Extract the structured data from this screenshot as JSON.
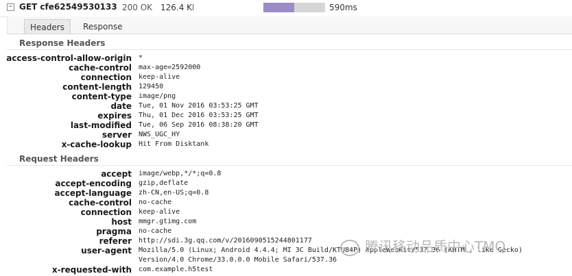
{
  "request": {
    "toggle_symbol": "−",
    "url": "GET cfe62549530133c",
    "status": "200 OK",
    "size": "126.4 KB",
    "time": "590ms",
    "timeline_fraction": 0.5
  },
  "tabs": [
    {
      "label": "Headers",
      "active": true
    },
    {
      "label": "Response",
      "active": false
    }
  ],
  "response_headers": {
    "title": "Response Headers",
    "rows": [
      {
        "name": "access-control-allow-origin",
        "value": "*"
      },
      {
        "name": "cache-control",
        "value": "max-age=2592000"
      },
      {
        "name": "connection",
        "value": "keep-alive"
      },
      {
        "name": "content-length",
        "value": "129450"
      },
      {
        "name": "content-type",
        "value": "image/png"
      },
      {
        "name": "date",
        "value": "Tue, 01 Nov 2016 03:53:25 GMT"
      },
      {
        "name": "expires",
        "value": "Thu, 01 Dec 2016 03:53:25 GMT"
      },
      {
        "name": "last-modified",
        "value": "Tue, 06 Sep 2016 08:38:20 GMT"
      },
      {
        "name": "server",
        "value": "NWS_UGC_HY"
      },
      {
        "name": "x-cache-lookup",
        "value": "Hit From Disktank"
      }
    ]
  },
  "request_headers": {
    "title": "Request Headers",
    "rows": [
      {
        "name": "accept",
        "value": "image/webp,*/*;q=0.8"
      },
      {
        "name": "accept-encoding",
        "value": "gzip,deflate"
      },
      {
        "name": "accept-language",
        "value": "zh-CN,en-US;q=0.8"
      },
      {
        "name": "cache-control",
        "value": "no-cache"
      },
      {
        "name": "connection",
        "value": "keep-alive"
      },
      {
        "name": "host",
        "value": "mmgr.gtimg.com"
      },
      {
        "name": "pragma",
        "value": "no-cache"
      },
      {
        "name": "referer",
        "value": "http://sdi.3g.qq.com/v/2016090515244801177"
      },
      {
        "name": "user-agent",
        "value": "Mozilla/5.0 (Linux; Android 4.4.4; MI 3C Build/KTU84P) AppleWebKit/537.36 (KHTML, like Gecko) Version/4.0 Chrome/33.0.0.0 Mobile Safari/537.36"
      },
      {
        "name": "x-requested-with",
        "value": "com.example.h5test"
      }
    ]
  },
  "watermark": {
    "text": "腾讯移动品质中心TMQ",
    "icon": "wechat-icon"
  }
}
